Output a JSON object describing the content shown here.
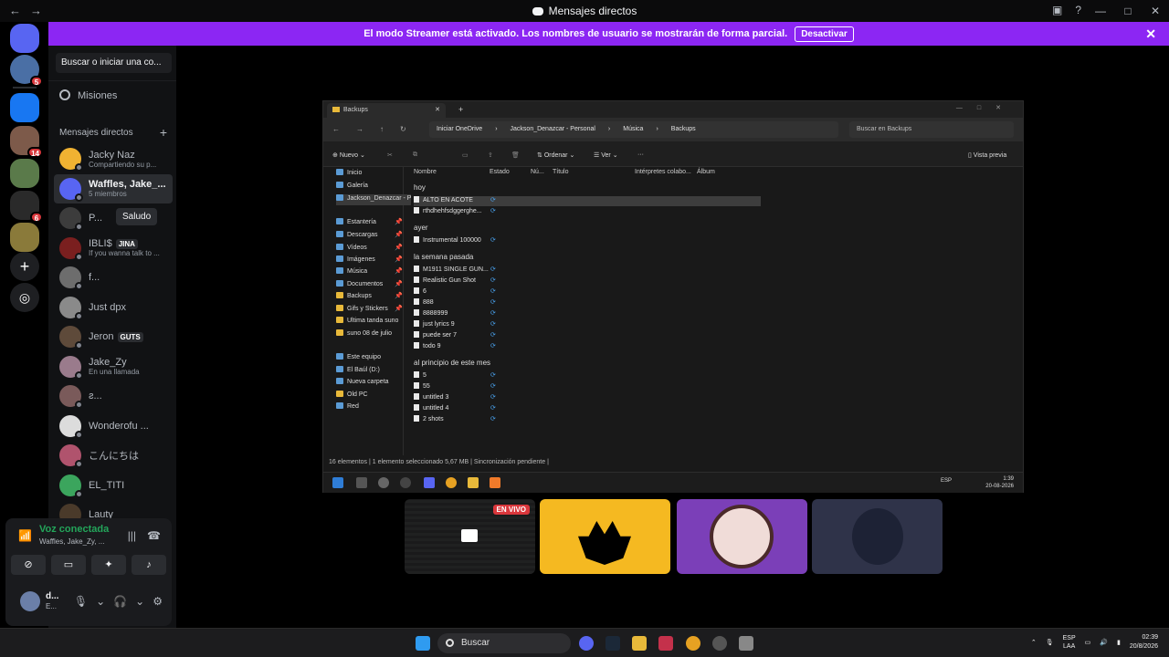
{
  "window": {
    "title": "Mensajes directos"
  },
  "banner": {
    "text": "El modo Streamer está activado. Los nombres de usuario se mostrarán de forma parcial.",
    "button": "Desactivar"
  },
  "rail": {
    "badges": [
      "5",
      "14",
      "6"
    ]
  },
  "sidebar": {
    "search": "Buscar o iniciar una co...",
    "missions": "Misiones",
    "dm_header": "Mensajes directos",
    "dms": [
      {
        "name": "Jacky Naz",
        "sub": "Compartiendo su p...",
        "color": "#f0b232"
      },
      {
        "name": "Waffles, Jake_...",
        "sub": "5 miembros",
        "color": "#5865f2"
      },
      {
        "name": "P...",
        "sub": "",
        "color": "#3c3c3c"
      },
      {
        "name": "IBLI$",
        "sub": "If you wanna talk to ...",
        "color": "#7a1f1f",
        "tag": "JINA"
      },
      {
        "name": "f...",
        "sub": "",
        "color": "#6d6d6d"
      },
      {
        "name": "Just dpx",
        "sub": "",
        "color": "#8a8a8a"
      },
      {
        "name": "Jeron",
        "sub": "",
        "color": "#5e4a3a",
        "tag": "GUTS"
      },
      {
        "name": "Jake_Zy",
        "sub": "En una llamada",
        "color": "#9a7b8c"
      },
      {
        "name": "ƨ...",
        "sub": "",
        "color": "#7a5a5a"
      },
      {
        "name": "Wonderofu ...",
        "sub": "",
        "color": "#dcdcdc"
      },
      {
        "name": "こんにちは",
        "sub": "",
        "color": "#b0536d"
      },
      {
        "name": "EL_TITI",
        "sub": "",
        "color": "#3ba55d"
      },
      {
        "name": "Lauty",
        "sub": "",
        "color": "#4a3a2a"
      }
    ],
    "saludo": "Saludo"
  },
  "voice": {
    "status": "Voz conectada",
    "channel": "Waffles, Jake_Zy, ...",
    "user_name": "d...",
    "user_sub": "E..."
  },
  "explorer": {
    "tab": "Backups",
    "path": [
      "Iniciar OneDrive",
      "Jackson_Denazcar - Personal",
      "Música",
      "Backups"
    ],
    "search": "Buscar en Backups",
    "toolbar": {
      "new": "Nuevo",
      "sort": "Ordenar",
      "view": "Ver",
      "preview": "Vista previa"
    },
    "nav": [
      "Inicio",
      "Galería",
      "Jackson_Denazcar - P",
      "Estantería",
      "Descargas",
      "Vídeos",
      "Imágenes",
      "Música",
      "Documentos",
      "Backups",
      "Gifs y Stickers",
      "Ultima tanda suno",
      "suno 08 de julio",
      "Este equipo",
      "El Baúl (D:)",
      "Nueva carpeta",
      "Old PC",
      "Red"
    ],
    "columns": [
      "Nombre",
      "Estado",
      "Nú...",
      "Título",
      "Intérpretes colabo...",
      "Álbum"
    ],
    "groups": [
      {
        "label": "hoy",
        "files": [
          "ALTO EN ACOTE",
          "rthdhehfsdggerghe..."
        ]
      },
      {
        "label": "ayer",
        "files": [
          "Instrumental 100000"
        ]
      },
      {
        "label": "la semana pasada",
        "files": [
          "M1911 SINGLE GUN...",
          "Realistic Gun Shot",
          "6",
          "888",
          "8888999",
          "just lyrics 9",
          "puede ser 7",
          "todo 9"
        ]
      },
      {
        "label": "al principio de este mes",
        "files": [
          "5",
          "55",
          "untitled 3",
          "untitled 4",
          "2 shots"
        ]
      }
    ],
    "status": "16 elementos  |  1 elemento seleccionado 5,67 MB  |  Sincronización pendiente  |",
    "clock": [
      "1:39",
      "20-08-2026"
    ],
    "lang": "ESP"
  },
  "tiles": {
    "live": "EN VIVO"
  },
  "taskbar": {
    "search": "Buscar",
    "lang": "ESP",
    "lang2": "LAA",
    "time": "02:39",
    "date": "20/8/2026"
  }
}
